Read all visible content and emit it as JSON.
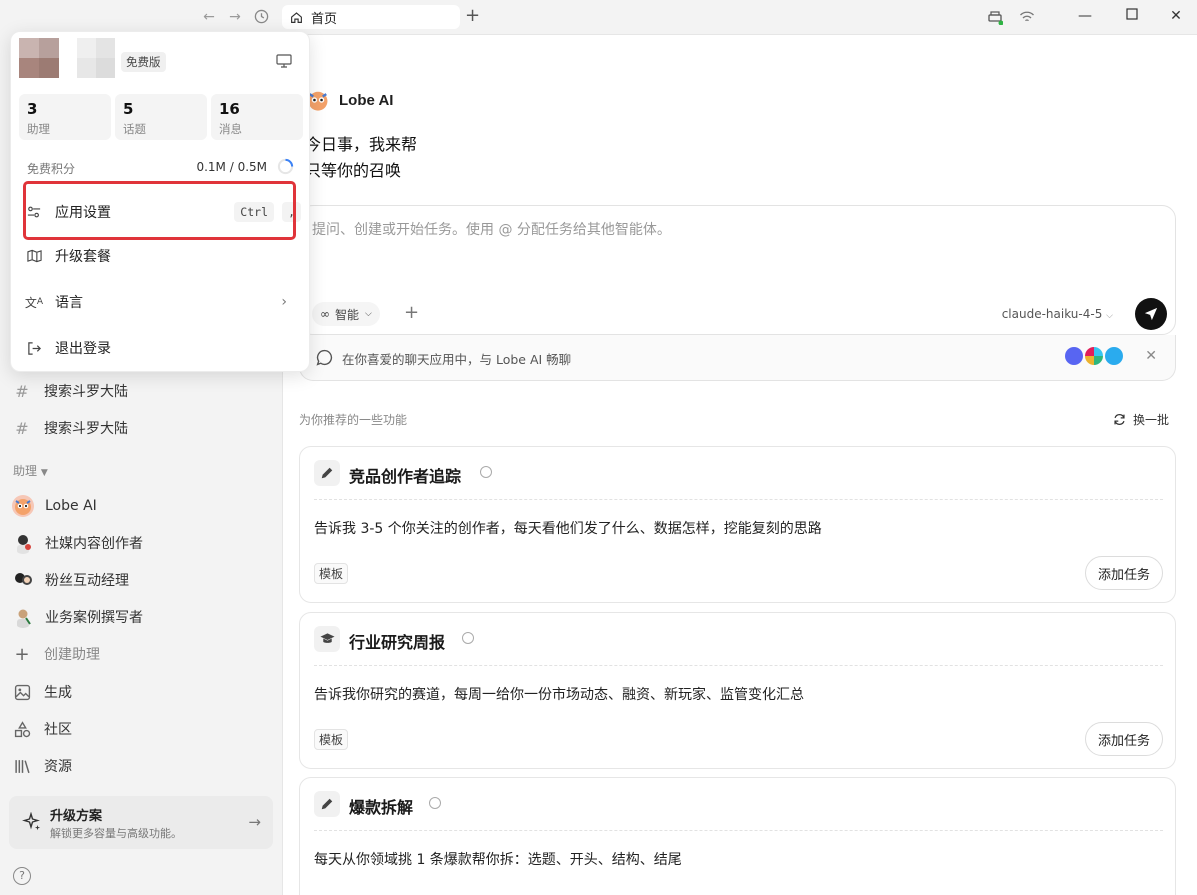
{
  "titlebar": {
    "tab_title": "首页",
    "nav_icons": [
      "arrow-left-icon",
      "arrow-right-icon",
      "history-icon"
    ]
  },
  "popup": {
    "plan": "免费版",
    "stats": [
      {
        "num": "3",
        "label": "助理"
      },
      {
        "num": "5",
        "label": "话题"
      },
      {
        "num": "16",
        "label": "消息"
      }
    ],
    "credits_label": "免费积分",
    "credits_value": "0.1M / 0.5M",
    "menu": {
      "settings": "应用设置",
      "settings_key1": "Ctrl",
      "settings_key2": ",",
      "upgrade": "升级套餐",
      "language": "语言",
      "logout": "退出登录"
    },
    "highlight_color": "#e0343a"
  },
  "sidebar": {
    "topics": [
      "搜索斗罗大陆",
      "搜索斗罗大陆"
    ],
    "assistants_label": "助理",
    "assistants": [
      "Lobe AI",
      "社媒内容创作者",
      "粉丝互动经理",
      "业务案例撰写者"
    ],
    "create_assistant": "创建助理",
    "nav": [
      "生成",
      "社区",
      "资源"
    ],
    "upgrade_title": "升级方案",
    "upgrade_sub": "解锁更多容量与高级功能。"
  },
  "main": {
    "agent_name": "Lobe AI",
    "greeting_line1": "今日事，我来帮",
    "greeting_line2": "只等你的召唤",
    "input_placeholder": "提问、创建或开始任务。使用 @ 分配任务给其他智能体。",
    "mode_label": "智能",
    "model": "claude-haiku-4-5",
    "chat_banner": "在你喜爱的聊天应用中，与 Lobe AI 畅聊",
    "recommend_label": "为你推荐的一些功能",
    "refresh_label": "换一批",
    "cards": [
      {
        "title": "竞品创作者追踪",
        "desc": "告诉我 3-5 个你关注的创作者，每天看他们发了什么、数据怎样，挖能复刻的思路",
        "tag": "模板",
        "action": "添加任务",
        "icon": "pencil-icon"
      },
      {
        "title": "行业研究周报",
        "desc": "告诉我你研究的赛道，每周一给你一份市场动态、融资、新玩家、监管变化汇总",
        "tag": "模板",
        "action": "添加任务",
        "icon": "graduation-cap-icon"
      },
      {
        "title": "爆款拆解",
        "desc": "每天从你领域挑 1 条爆款帮你拆：选题、开头、结构、结尾",
        "tag": "模板",
        "action": "添加任务",
        "icon": "pencil-icon"
      }
    ]
  },
  "colors": {
    "accent": "#111111",
    "app_bg": "#f3f3f3"
  }
}
